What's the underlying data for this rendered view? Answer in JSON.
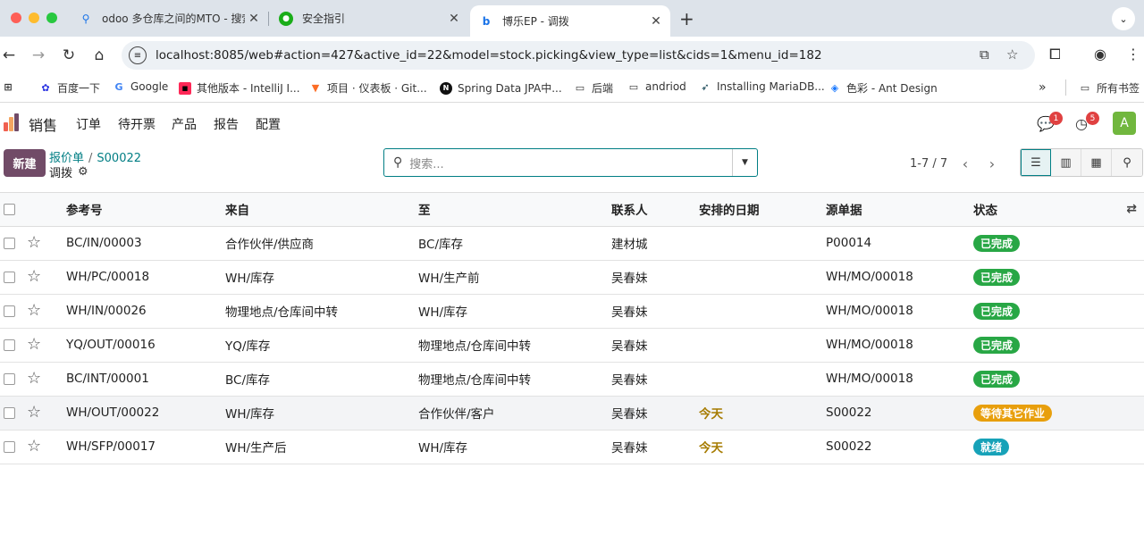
{
  "browser": {
    "tabs": [
      {
        "title": "odoo 多仓库之间的MTO - 搜索"
      },
      {
        "title": "安全指引"
      },
      {
        "title": "博乐EP - 调拨"
      }
    ],
    "url": "localhost:8085/web#action=427&active_id=22&model=stock.picking&view_type=list&cids=1&menu_id=182",
    "bookmarks": [
      "百度一下",
      "Google",
      "其他版本 - IntelliJ I...",
      "项目 · 仪表板 · Git...",
      "Spring Data JPA中...",
      "后端",
      "andriod",
      "Installing MariaDB...",
      "色彩 - Ant Design"
    ],
    "bookmarks_more": "»",
    "all_bookmarks": "所有书签"
  },
  "app": {
    "name": "销售",
    "menu": [
      "订单",
      "待开票",
      "产品",
      "报告",
      "配置"
    ],
    "chat_count": "1",
    "activity_count": "5",
    "avatar_letter": "A"
  },
  "control": {
    "new_label": "新建",
    "breadcrumb": [
      "报价单",
      "S00022"
    ],
    "breadcrumb_sep": "/",
    "current": "调拨",
    "search_placeholder": "搜索...",
    "pager": "1-7 / 7"
  },
  "table": {
    "headers": [
      "参考号",
      "来自",
      "至",
      "联系人",
      "安排的日期",
      "源单据",
      "状态"
    ],
    "rows": [
      {
        "ref": "BC/IN/00003",
        "from": "合作伙伴/供应商",
        "to": "BC/库存",
        "contact": "建材城",
        "date": "",
        "source": "P00014",
        "status": "已完成",
        "status_color": "#28a745"
      },
      {
        "ref": "WH/PC/00018",
        "from": "WH/库存",
        "to": "WH/生产前",
        "contact": "吴春妹",
        "date": "",
        "source": "WH/MO/00018",
        "status": "已完成",
        "status_color": "#28a745"
      },
      {
        "ref": "WH/IN/00026",
        "from": "物理地点/仓库间中转",
        "to": "WH/库存",
        "contact": "吴春妹",
        "date": "",
        "source": "WH/MO/00018",
        "status": "已完成",
        "status_color": "#28a745"
      },
      {
        "ref": "YQ/OUT/00016",
        "from": "YQ/库存",
        "to": "物理地点/仓库间中转",
        "contact": "吴春妹",
        "date": "",
        "source": "WH/MO/00018",
        "status": "已完成",
        "status_color": "#28a745"
      },
      {
        "ref": "BC/INT/00001",
        "from": "BC/库存",
        "to": "物理地点/仓库间中转",
        "contact": "吴春妹",
        "date": "",
        "source": "WH/MO/00018",
        "status": "已完成",
        "status_color": "#28a745"
      },
      {
        "ref": "WH/OUT/00022",
        "from": "WH/库存",
        "to": "合作伙伴/客户",
        "contact": "吴春妹",
        "date": "今天",
        "source": "S00022",
        "status": "等待其它作业",
        "status_color": "#e89f0c"
      },
      {
        "ref": "WH/SFP/00017",
        "from": "WH/生产后",
        "to": "WH/库存",
        "contact": "吴春妹",
        "date": "今天",
        "source": "S00022",
        "status": "就绪",
        "status_color": "#17a2b8"
      }
    ]
  },
  "colors": {
    "brand": "#714b67",
    "link": "#017e84"
  }
}
